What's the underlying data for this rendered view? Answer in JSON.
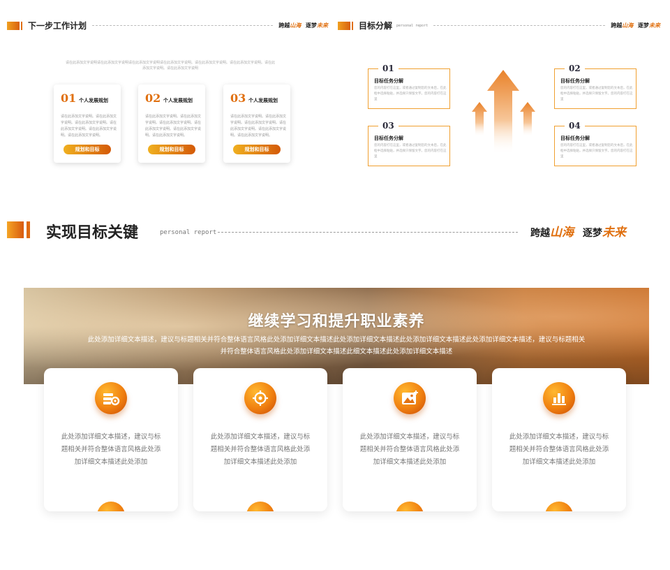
{
  "top_left": {
    "title": "下一步工作计划",
    "slogan": {
      "part1": "跨越",
      "accent1": "山海",
      "part2": "逐梦",
      "accent2": "未来"
    },
    "desc": "请在此添加文字说明请在此添加文字说明请在此添加文字说明请在此添加文字说明。请在此添加文字说明。请在此添加文字说明。请在此添加文字说明。请在此添加文字说明",
    "cards": [
      {
        "num": "01",
        "title": "个人发展规划",
        "text": "请在此添加文字说明。请在此添加文字说明。请在此添加文字说明。请在此添加文字说明。请在此添加文字说明。请在此添加文字说明。",
        "button": "规划和目标"
      },
      {
        "num": "02",
        "title": "个人发展规划",
        "text": "请在此添加文字说明。请在此添加文字说明。请在此添加文字说明。请在此添加文字说明。请在此添加文字说明。请在此添加文字说明。",
        "button": "规划和目标"
      },
      {
        "num": "03",
        "title": "个人发展规划",
        "text": "请在此添加文字说明。请在此添加文字说明。请在此添加文字说明。请在此添加文字说明。请在此添加文字说明。请在此添加文字说明。",
        "button": "规划和目标"
      }
    ]
  },
  "top_right": {
    "title": "目标分解",
    "subtitle": "personal report",
    "slogan": {
      "part1": "跨越",
      "accent1": "山海",
      "part2": "逐梦",
      "accent2": "未来"
    },
    "boxes": [
      {
        "num": "01",
        "title": "目标任务分解",
        "text": "您的内容打在这里，或者通过复制您的文本后，在此框中选择粘贴，并选择只保留文字。您的内容打在这里"
      },
      {
        "num": "02",
        "title": "目标任务分解",
        "text": "您的内容打在这里，或者通过复制您的文本后，在此框中选择粘贴，并选择只保留文字。您的内容打在这里"
      },
      {
        "num": "03",
        "title": "目标任务分解",
        "text": "您的内容打在这里，或者通过复制您的文本后，在此框中选择粘贴，并选择只保留文字。您的内容打在这里"
      },
      {
        "num": "04",
        "title": "目标任务分解",
        "text": "您的内容打在这里，或者通过复制您的文本后，在此框中选择粘贴，并选择只保留文字。您的内容打在这里"
      }
    ]
  },
  "main": {
    "title": "实现目标关键",
    "subtitle": "personal report",
    "slogan": {
      "part1": "跨越",
      "accent1": "山海",
      "part2": "逐梦",
      "accent2": "未来"
    },
    "banner_title": "继续学习和提升职业素养",
    "banner_text": "此处添加详细文本描述，建议与标题相关并符合整体语言风格此处添加详细文本描述此处添加详细文本描述此处添加详细文本描述此处添加详细文本描述，建议与标题相关并符合整体语言风格此处添加详细文本描述此细文本描述此处添加详细文本描述",
    "features": [
      {
        "icon": "settings-icon",
        "text": "此处添加详细文本描述，建议与标题相关并符合整体语言风格此处添加详细文本描述此处添加"
      },
      {
        "icon": "target-icon",
        "text": "此处添加详细文本描述，建议与标题相关并符合整体语言风格此处添加详细文本描述此处添加"
      },
      {
        "icon": "image-icon",
        "text": "此处添加详细文本描述，建议与标题相关并符合整体语言风格此处添加详细文本描述此处添加"
      },
      {
        "icon": "bar-chart-icon",
        "text": "此处添加详细文本描述，建议与标题相关并符合整体语言风格此处添加详细文本描述此处添加"
      }
    ]
  },
  "colors": {
    "accent": "#e07010",
    "accent_light": "#f5a525",
    "text_dark": "#222222",
    "text_muted": "#777777"
  }
}
